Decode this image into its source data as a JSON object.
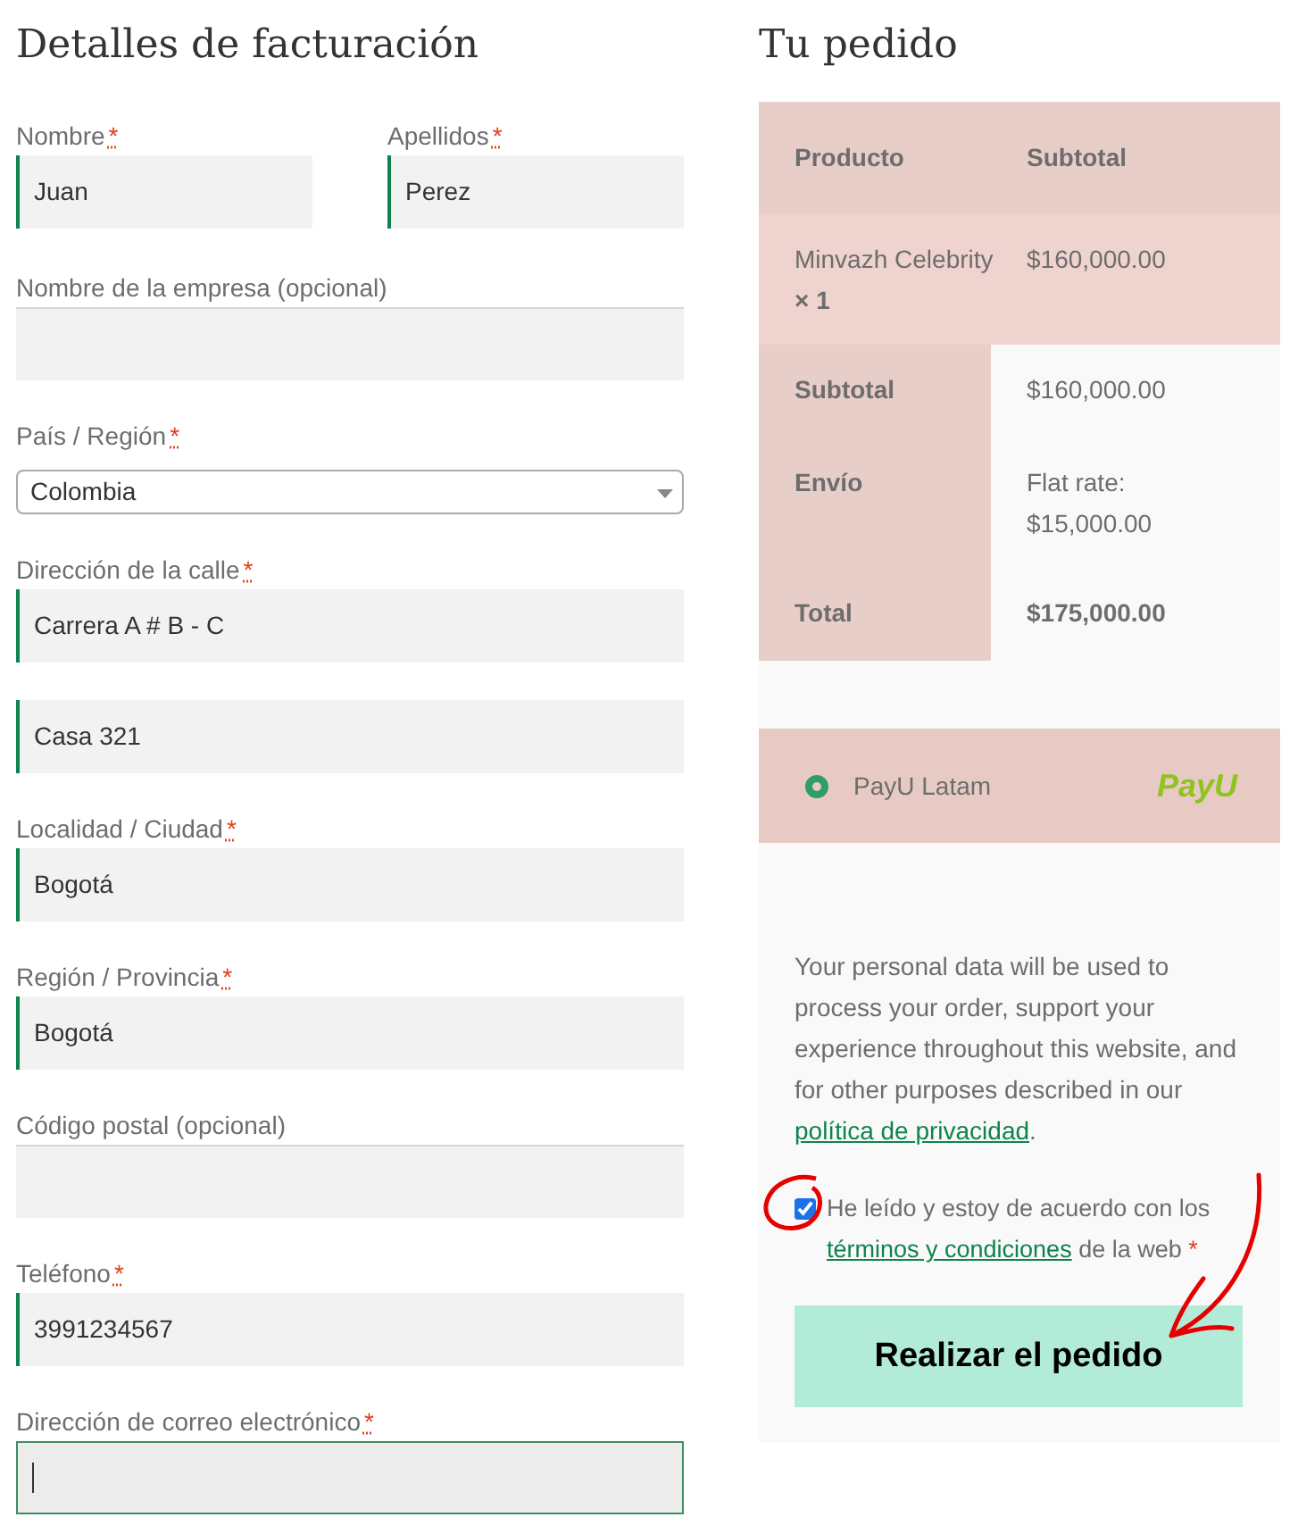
{
  "billing": {
    "title": "Detalles de facturación",
    "name_row": [
      {
        "kind": "text",
        "label": "Nombre",
        "mark": "*",
        "value": "Juan",
        "validated": true,
        "focused": false
      },
      {
        "kind": "text",
        "label": "Apellidos",
        "mark": "*",
        "value": "Perez",
        "validated": true,
        "focused": false
      }
    ],
    "fields": [
      {
        "kind": "text",
        "label": "Nombre de la empresa (opcional)",
        "validated": false,
        "focused": false
      },
      {
        "kind": "select",
        "label": "País / Región",
        "mark": "*",
        "value": "Colombia"
      },
      {
        "kind": "text",
        "label": "Dirección de la calle",
        "mark": "*",
        "value": "Carrera A # B - C",
        "validated": true,
        "focused": false
      },
      {
        "kind": "text",
        "value": "Casa 321",
        "validated": true,
        "focused": false
      },
      {
        "kind": "text",
        "label": "Localidad / Ciudad",
        "mark": "*",
        "value": "Bogotá",
        "validated": true,
        "focused": false
      },
      {
        "kind": "text",
        "label": "Región / Provincia",
        "mark": "*",
        "value": "Bogotá",
        "validated": true,
        "focused": false
      },
      {
        "kind": "text",
        "label": "Código postal (opcional)",
        "validated": false,
        "focused": false
      },
      {
        "kind": "text",
        "label": "Teléfono",
        "mark": "*",
        "value": "3991234567",
        "validated": true,
        "focused": false
      },
      {
        "kind": "text",
        "label": "Dirección de correo electrónico",
        "mark": "*",
        "focused": true
      }
    ]
  },
  "order": {
    "title": "Tu pedido",
    "columns": [
      "Producto",
      "Subtotal"
    ],
    "items": [
      {
        "name": "Minvazh Celebrity",
        "qty": "× 1",
        "subtotal": "$160,000.00"
      }
    ],
    "totals": [
      {
        "label": "Subtotal",
        "value": "$160,000.00",
        "bold": false
      },
      {
        "label": "Envío",
        "value": "Flat rate: $15,000.00",
        "bold": false
      },
      {
        "label": "Total",
        "value": "$175,000.00",
        "bold": true
      }
    ],
    "payment_methods": [
      {
        "label": "PayU Latam",
        "selected": true,
        "logo_text": "PayU"
      }
    ],
    "privacy": {
      "text": "Your personal data will be used to process your order, support your experience throughout this website, and for other purposes described in our",
      "link": "política de privacidad",
      "end": "."
    },
    "terms": {
      "checked": true,
      "text": "He leído y estoy de acuerdo con los",
      "link": "términos y condiciones",
      "after": "de la web",
      "mark": "*"
    },
    "button": "Realizar el pedido"
  }
}
